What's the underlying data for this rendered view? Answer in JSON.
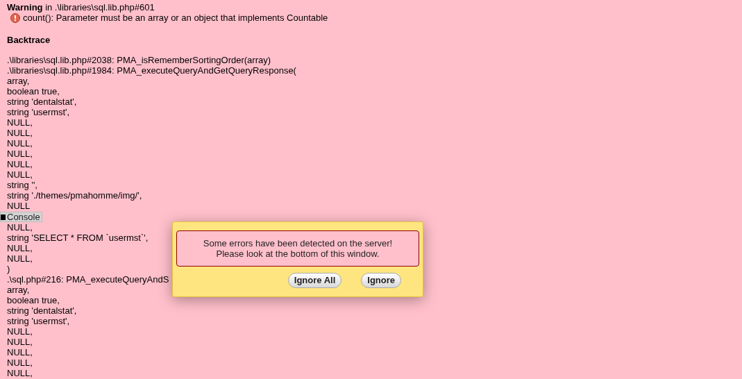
{
  "warning": {
    "title": "Warning",
    "location": "in .\\libraries\\sql.lib.php#601",
    "message": "count(): Parameter must be an array or an object that implements Countable"
  },
  "backtrace": {
    "heading": "Backtrace",
    "lines_before_console": [
      ".\\libraries\\sql.lib.php#2038: PMA_isRememberSortingOrder(array)",
      ".\\libraries\\sql.lib.php#1984: PMA_executeQueryAndGetQueryResponse(",
      "array,",
      "boolean true,",
      "string 'dentalstat',",
      "string 'usermst',",
      "NULL,",
      "NULL,",
      "NULL,",
      "NULL,",
      "NULL,",
      "NULL,",
      "string '',",
      "string './themes/pmahomme/img/',",
      "NULL"
    ],
    "lines_after_console": [
      "NULL,",
      "string 'SELECT * FROM `usermst`',",
      "NULL,",
      "NULL,",
      ")",
      ".\\sql.php#216: PMA_executeQueryAndS",
      "array,",
      "boolean true,",
      "string 'dentalstat',",
      "string 'usermst',",
      "NULL,",
      "NULL,",
      "NULL,",
      "NULL,",
      "NULL,"
    ]
  },
  "console": {
    "label": "Console"
  },
  "dialog": {
    "message_lines": [
      "Some errors have been detected on the server!",
      "Please look at the bottom of this window."
    ],
    "buttons": [
      "Ignore All",
      "Ignore"
    ]
  }
}
